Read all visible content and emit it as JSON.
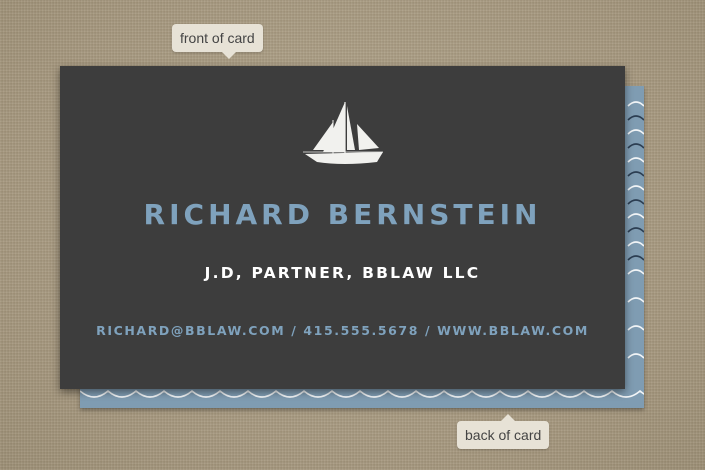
{
  "labels": {
    "front": "front of card",
    "back": "back of card"
  },
  "card": {
    "name": "RICHARD BERNSTEIN",
    "title": "J.D, PARTNER, BBLAW LLC",
    "contact": "RICHARD@BBLAW.COM / 415.555.5678 / WWW.BBLAW.COM",
    "icon": "sailboat-icon"
  },
  "colors": {
    "front_card": "#3d3d3d",
    "back_card": "#7f9cb2",
    "accent_text": "#7fa2bd",
    "white_text": "#ffffff",
    "label_bg": "#e7e2d6"
  }
}
